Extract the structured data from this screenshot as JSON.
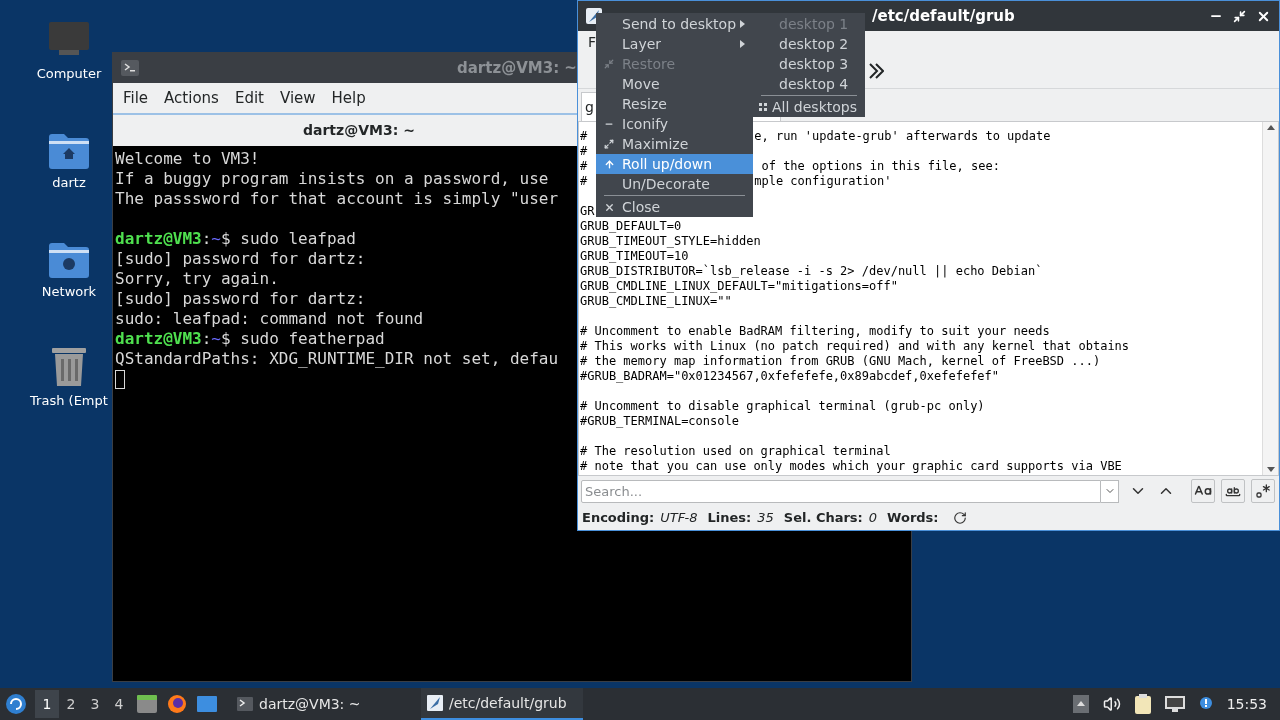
{
  "desktop_icons": [
    {
      "label": "Computer",
      "kind": "computer"
    },
    {
      "label": "dartz",
      "kind": "home"
    },
    {
      "label": "Network",
      "kind": "network"
    },
    {
      "label": "Trash (Empt",
      "kind": "trash"
    }
  ],
  "terminal": {
    "title": "dartz@VM3: ~",
    "menu": [
      "File",
      "Actions",
      "Edit",
      "View",
      "Help"
    ],
    "tab": "dartz@VM3: ~",
    "lines": [
      {
        "kind": "text",
        "text": "Welcome to VM3!"
      },
      {
        "kind": "text",
        "text": "If a buggy program insists on a password, use"
      },
      {
        "kind": "text",
        "text": "The passsword for that account is simply \"user"
      },
      {
        "kind": "blank"
      },
      {
        "kind": "prompt",
        "user": "dartz@VM3",
        "sep": ":",
        "path": "~",
        "command": "$ sudo leafpad"
      },
      {
        "kind": "text",
        "text": "[sudo] password for dartz:"
      },
      {
        "kind": "text",
        "text": "Sorry, try again."
      },
      {
        "kind": "text",
        "text": "[sudo] password for dartz:"
      },
      {
        "kind": "text",
        "text": "sudo: leafpad: command not found"
      },
      {
        "kind": "prompt",
        "user": "dartz@VM3",
        "sep": ":",
        "path": "~",
        "command": "$ sudo featherpad"
      },
      {
        "kind": "text",
        "text": "QStandardPaths: XDG_RUNTIME_DIR not set, defau"
      },
      {
        "kind": "cursor"
      }
    ]
  },
  "editor": {
    "title": "/etc/default/grub",
    "menu": [
      "F"
    ],
    "tab": "g",
    "lines": [
      {
        "kind": "split",
        "text": "#",
        "rest": "e, run 'update-grub' afterwards to update"
      },
      {
        "kind": "text",
        "text": "#"
      },
      {
        "kind": "split",
        "text": "#",
        "rest": " of the options in this file, see:"
      },
      {
        "kind": "split",
        "text": "#",
        "rest": "mple configuration'"
      },
      {
        "kind": "blank"
      },
      {
        "kind": "text",
        "text": "GR"
      },
      {
        "kind": "text",
        "text": "GRUB_DEFAULT=0"
      },
      {
        "kind": "text",
        "text": "GRUB_TIMEOUT_STYLE=hidden"
      },
      {
        "kind": "text",
        "text": "GRUB_TIMEOUT=10"
      },
      {
        "kind": "text",
        "text": "GRUB_DISTRIBUTOR=`lsb_release -i -s 2> /dev/null || echo Debian`"
      },
      {
        "kind": "text",
        "text": "GRUB_CMDLINE_LINUX_DEFAULT=\"mitigations=off\""
      },
      {
        "kind": "text",
        "text": "GRUB_CMDLINE_LINUX=\"\""
      },
      {
        "kind": "blank"
      },
      {
        "kind": "text",
        "text": "# Uncomment to enable BadRAM filtering, modify to suit your needs"
      },
      {
        "kind": "text",
        "text": "# This works with Linux (no patch required) and with any kernel that obtains"
      },
      {
        "kind": "text",
        "text": "# the memory map information from GRUB (GNU Mach, kernel of FreeBSD ...)"
      },
      {
        "kind": "text",
        "text": "#GRUB_BADRAM=\"0x01234567,0xfefefefe,0x89abcdef,0xefefefef\""
      },
      {
        "kind": "blank"
      },
      {
        "kind": "text",
        "text": "# Uncomment to disable graphical terminal (grub-pc only)"
      },
      {
        "kind": "text",
        "text": "#GRUB_TERMINAL=console"
      },
      {
        "kind": "blank"
      },
      {
        "kind": "text",
        "text": "# The resolution used on graphical terminal"
      },
      {
        "kind": "text",
        "text": "# note that you can use only modes which your graphic card supports via VBE"
      }
    ],
    "search": {
      "placeholder": "Search..."
    },
    "status": [
      {
        "label": "Encoding:",
        "value": "UTF-8"
      },
      {
        "label": "Lines:",
        "value": "35"
      },
      {
        "label": "Sel. Chars:",
        "value": "0"
      },
      {
        "label": "Words:"
      }
    ]
  },
  "context_menu": {
    "items": [
      {
        "label": "Send to desktop",
        "kind": "submenu",
        "disabled": false,
        "selected": false
      },
      {
        "label": "Layer",
        "kind": "submenu",
        "disabled": false,
        "selected": false
      },
      {
        "label": "Restore",
        "kind": "restore",
        "disabled": true,
        "selected": false
      },
      {
        "label": "Move",
        "kind": "plain",
        "disabled": false,
        "selected": false
      },
      {
        "label": "Resize",
        "kind": "plain",
        "disabled": false,
        "selected": false
      },
      {
        "label": "Iconify",
        "kind": "iconify",
        "disabled": false,
        "selected": false
      },
      {
        "label": "Maximize",
        "kind": "maximize",
        "disabled": false,
        "selected": false
      },
      {
        "label": "Roll up/down",
        "kind": "rollup",
        "disabled": false,
        "selected": true
      },
      {
        "label": "Un/Decorate",
        "kind": "plain",
        "disabled": false,
        "selected": false
      },
      {
        "label": "Close",
        "kind": "close",
        "disabled": false,
        "selected": false
      }
    ],
    "submenu": [
      {
        "label": "desktop 1",
        "kind": "desktop",
        "disabled": true
      },
      {
        "label": "desktop 2",
        "kind": "desktop",
        "disabled": false
      },
      {
        "label": "desktop 3",
        "kind": "desktop",
        "disabled": false
      },
      {
        "label": "desktop 4",
        "kind": "desktop",
        "disabled": false
      },
      {
        "label": "All desktops",
        "kind": "all",
        "disabled": false
      }
    ]
  },
  "taskbar": {
    "workspaces": [
      {
        "label": "1",
        "selected": true
      },
      {
        "label": "2",
        "selected": false
      },
      {
        "label": "3",
        "selected": false
      },
      {
        "label": "4",
        "selected": false
      }
    ],
    "tasks": [
      {
        "label": "dartz@VM3: ~",
        "kind": "terminal",
        "selected": false
      },
      {
        "label": "/etc/default/grub",
        "kind": "editor",
        "selected": true
      }
    ],
    "clock": "15:53"
  }
}
